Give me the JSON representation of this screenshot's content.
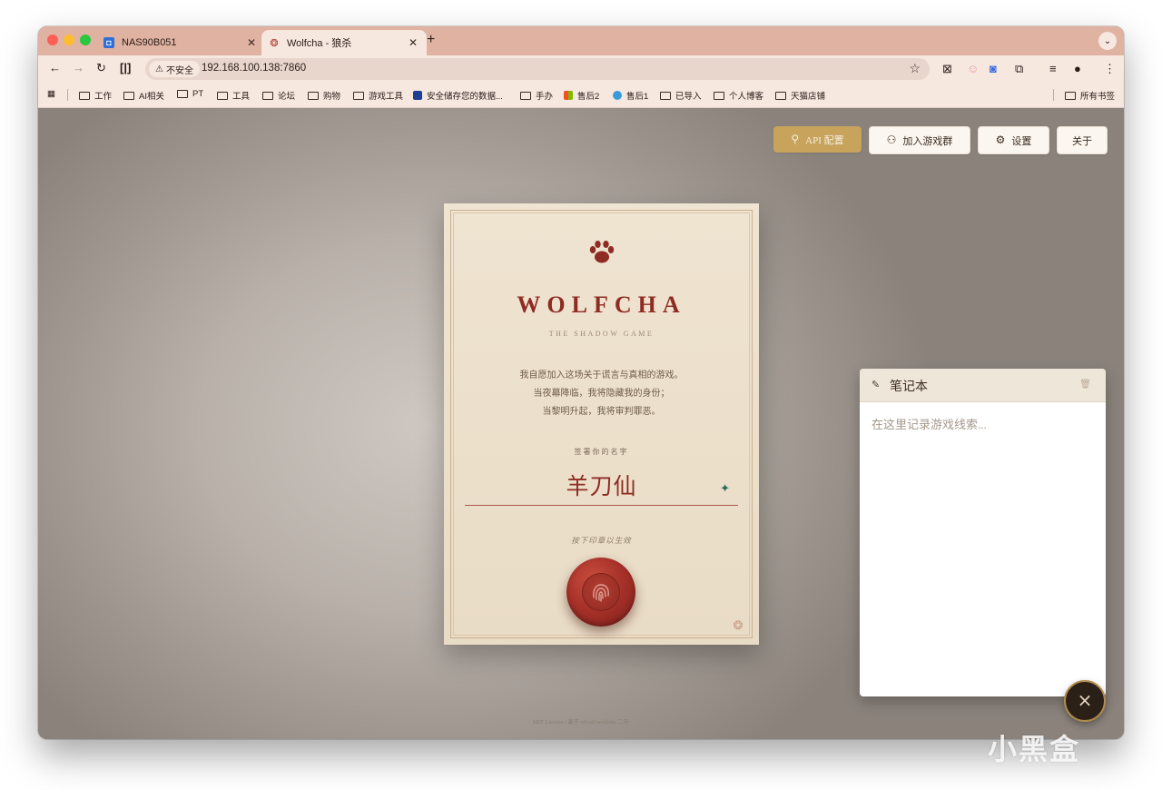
{
  "browser": {
    "tabs": [
      {
        "title": "NAS90B051"
      },
      {
        "title": "Wolfcha - 狼杀"
      }
    ],
    "address": {
      "security_label": "不安全",
      "url": "192.168.100.138:7860"
    },
    "bookmarks": [
      {
        "label": "工作"
      },
      {
        "label": "AI相关"
      },
      {
        "label": "PT"
      },
      {
        "label": "工具"
      },
      {
        "label": "论坛"
      },
      {
        "label": "购物"
      },
      {
        "label": "游戏工具"
      },
      {
        "label": "安全储存您的数据..."
      },
      {
        "label": "手办"
      },
      {
        "label": "售后2"
      },
      {
        "label": "售后1"
      },
      {
        "label": "已导入"
      },
      {
        "label": "个人博客"
      },
      {
        "label": "天猫店铺"
      }
    ],
    "all_bookmarks_label": "所有书签"
  },
  "header_buttons": {
    "api": "API 配置",
    "join_group": "加入游戏群",
    "settings": "设置",
    "about": "关于"
  },
  "card": {
    "title": "WOLFCHA",
    "subtitle": "THE SHADOW GAME",
    "oath_lines": [
      "我自愿加入这场关于谎言与真相的游戏。",
      "当夜幕降临，我将隐藏我的身份；",
      "当黎明升起，我将审判罪恶。"
    ],
    "sign_label": "签署你的名字",
    "player_name": "羊刀仙",
    "press_label": "按下印章以生效"
  },
  "notebook": {
    "title": "笔记本",
    "placeholder": "在这里记录游戏线索..."
  },
  "fab_label": "×",
  "footer": "MIT License | 基于 oil-oil/wolfcha 二开",
  "watermark": "小黑盒",
  "colors": {
    "tab_strip": "#dfb2a1",
    "toolbar": "#f6e7df",
    "accent_gold": "#c7a35c",
    "card_red": "#8e2c23",
    "card_paper": "#efe4d1"
  },
  "icons": {
    "api": "search-key-icon",
    "join_group": "users-icon",
    "settings": "gear-icon",
    "seal": "fingerprint-icon",
    "notebook": "edit-icon",
    "trash": "trash-icon",
    "close": "close-icon"
  }
}
